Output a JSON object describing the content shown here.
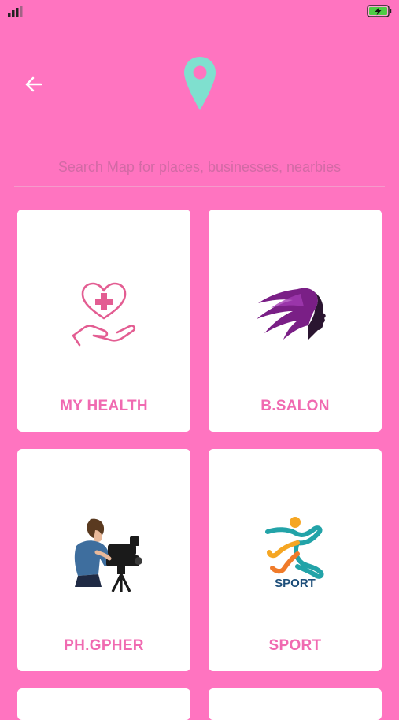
{
  "colors": {
    "background": "#ff74c0",
    "accent": "#f06ab1",
    "pin": "#7fe0cf"
  },
  "status": {
    "signal": "signal-icon",
    "battery": "battery-charging-icon"
  },
  "header": {
    "back_icon": "arrow-left-icon",
    "pin_icon": "map-pin-icon"
  },
  "search": {
    "placeholder": "Search Map for places, businesses, nearbies",
    "value": ""
  },
  "categories": [
    {
      "label": "MY HEALTH",
      "icon": "health-heart-hand-icon"
    },
    {
      "label": "B.SALON",
      "icon": "hair-salon-icon"
    },
    {
      "label": "PH.GPHER",
      "icon": "photographer-icon"
    },
    {
      "label": "SPORT",
      "icon": "sport-runner-icon"
    }
  ]
}
